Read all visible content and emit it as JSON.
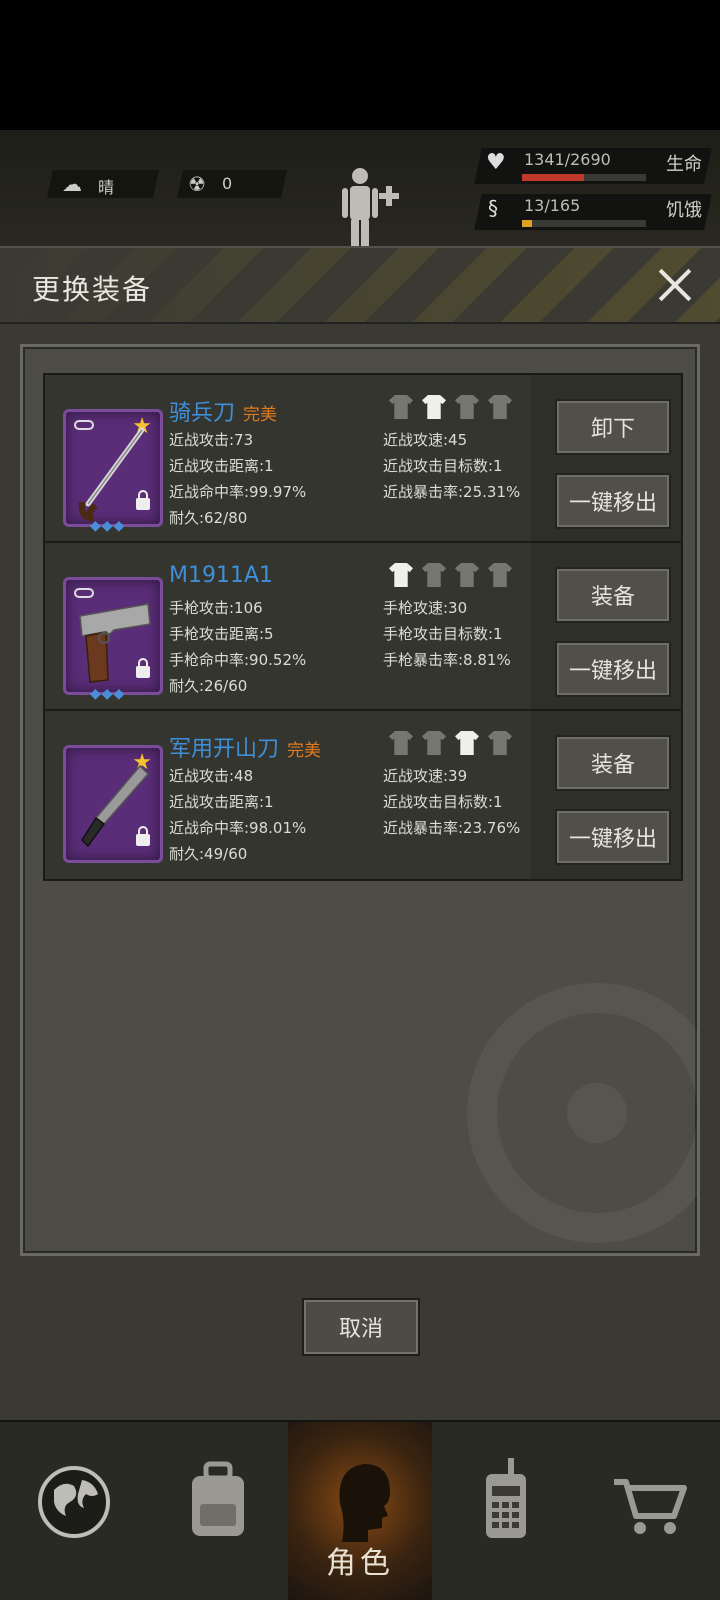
{
  "status": {
    "weather": "晴",
    "radiation": "0",
    "health": {
      "value": "1341/2690",
      "label": "生命",
      "fill": 0.5,
      "color": "#c0392b"
    },
    "hunger": {
      "value": "13/165",
      "label": "饥饿",
      "fill": 0.08,
      "color": "#e0a020"
    }
  },
  "dialog": {
    "title": "更换装备",
    "cancel_label": "取消"
  },
  "items": [
    {
      "name": "骑兵刀",
      "quality": "完美",
      "stats_left": [
        "近战攻击:73",
        "近战攻击距离:1",
        "近战命中率:99.97%",
        "耐久:62/80"
      ],
      "stats_right": [
        "近战攻速:45",
        "近战攻击目标数:1",
        "近战暴击率:25.31%"
      ],
      "btn_primary": "卸下",
      "btn_secondary": "一键移出"
    },
    {
      "name": "M1911A1",
      "quality": "",
      "stats_left": [
        "手枪攻击:106",
        "手枪攻击距离:5",
        "手枪命中率:90.52%",
        "耐久:26/60"
      ],
      "stats_right": [
        "手枪攻速:30",
        "手枪攻击目标数:1",
        "手枪暴击率:8.81%"
      ],
      "btn_primary": "装备",
      "btn_secondary": "一键移出"
    },
    {
      "name": "军用开山刀",
      "quality": "完美",
      "stats_left": [
        "近战攻击:48",
        "近战攻击距离:1",
        "近战命中率:98.01%",
        "耐久:49/60"
      ],
      "stats_right": [
        "近战攻速:39",
        "近战攻击目标数:1",
        "近战暴击率:23.76%"
      ],
      "btn_primary": "装备",
      "btn_secondary": "一键移出"
    }
  ],
  "nav": {
    "active_label": "角色"
  }
}
